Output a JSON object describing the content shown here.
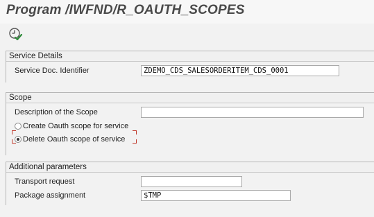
{
  "window": {
    "title": "Program /IWFND/R_OAUTH_SCOPES"
  },
  "toolbar": {
    "execute_icon": "execute-clock-check-icon"
  },
  "service_details": {
    "header": "Service Details",
    "service_doc_identifier": {
      "label": "Service Doc. Identifier",
      "value": "ZDEMO_CDS_SALESORDERITEM_CDS_0001"
    }
  },
  "scope": {
    "header": "Scope",
    "description": {
      "label": "Description of the Scope",
      "value": ""
    },
    "options": [
      {
        "label": "Create Oauth scope for service",
        "selected": false
      },
      {
        "label": "Delete Oauth scope of service",
        "selected": true
      }
    ]
  },
  "additional_parameters": {
    "header": "Additional parameters",
    "transport_request": {
      "label": "Transport request",
      "value": ""
    },
    "package_assignment": {
      "label": "Package assignment",
      "value": "$TMP"
    }
  },
  "colors": {
    "focus_marker": "#c0392b",
    "execute_icon_green": "#2e8b3a"
  }
}
